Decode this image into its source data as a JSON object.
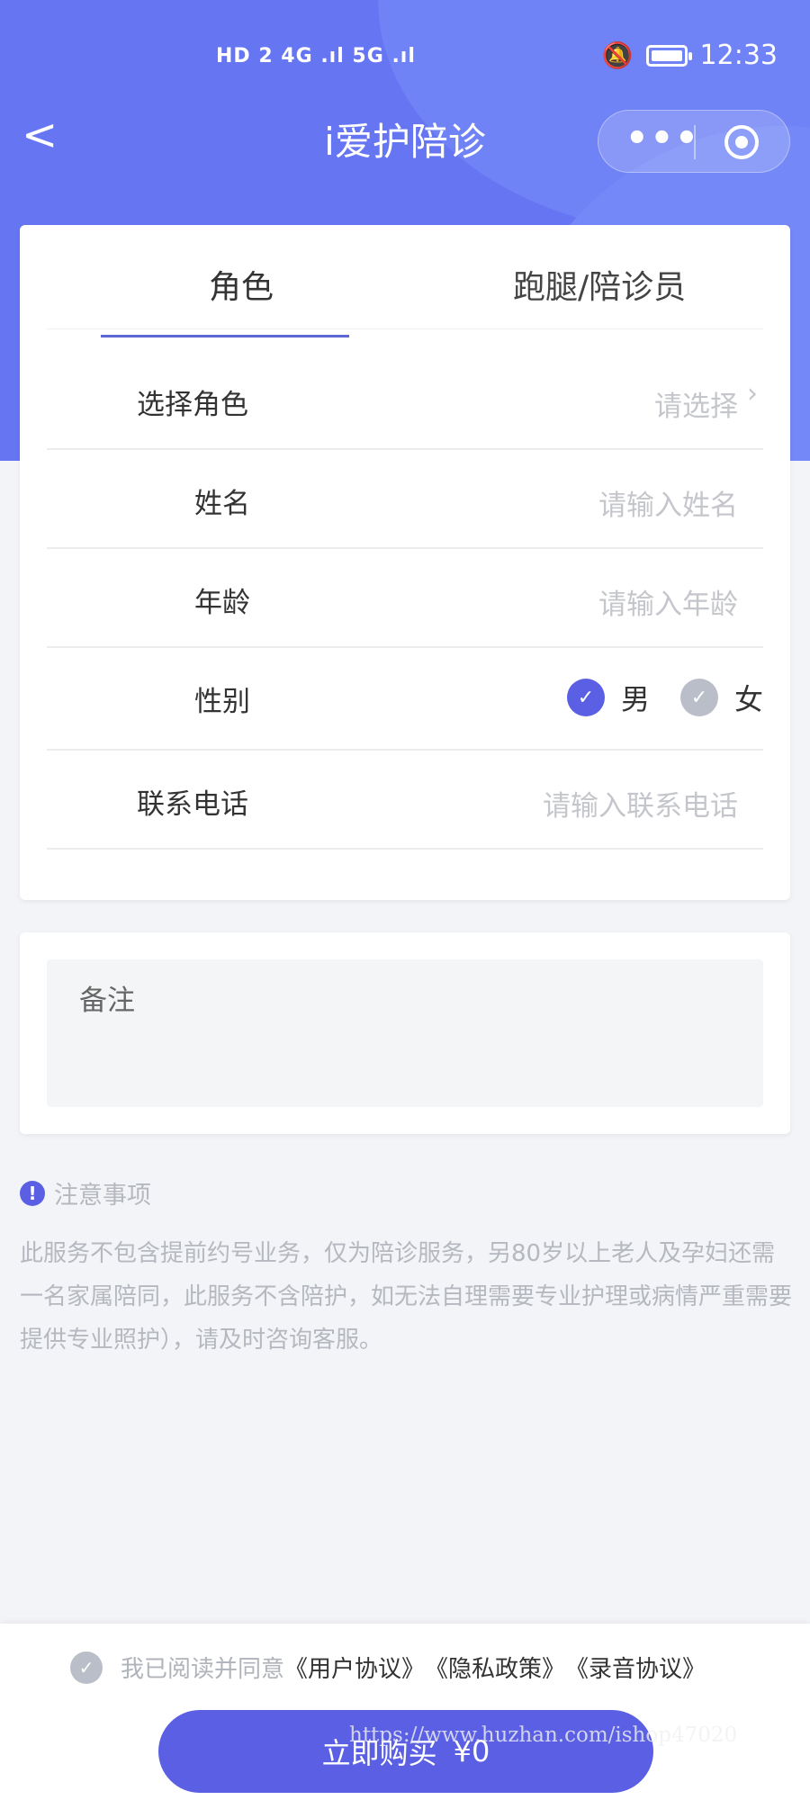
{
  "status_bar": {
    "network": "HD 2 4G .ıl 5G .ıl",
    "time": "12:33"
  },
  "navbar": {
    "back_label": "<",
    "title": "i爱护陪诊",
    "more_label": "•••"
  },
  "tabs": [
    {
      "label": "角色",
      "active": true
    },
    {
      "label": "跑腿/陪诊员",
      "active": false
    }
  ],
  "form": {
    "role": {
      "label": "选择角色",
      "placeholder": "请选择"
    },
    "name": {
      "label": "姓名",
      "placeholder": "请输入姓名"
    },
    "age": {
      "label": "年龄",
      "placeholder": "请输入年龄"
    },
    "gender": {
      "label": "性别",
      "options": [
        {
          "label": "男",
          "selected": true
        },
        {
          "label": "女",
          "selected": false
        }
      ]
    },
    "phone": {
      "label": "联系电话",
      "placeholder": "请输入联系电话"
    }
  },
  "remark": {
    "label": "备注"
  },
  "notice": {
    "title": "注意事项",
    "body": "此服务不包含提前约号业务，仅为陪诊服务，另80岁以上老人及孕妇还需一名家属陪同，此服务不含陪护，如无法自理需要专业护理或病情严重需要提供专业照护），请及时咨询客服。"
  },
  "agreement": {
    "prefix": "我已阅读并同意",
    "user": "《用户协议》",
    "privacy": "《隐私政策》",
    "recording": "《录音协议》"
  },
  "buy": {
    "label": "立即购买",
    "price": "¥0"
  },
  "watermark": "https://www.huzhan.com/ishop47020",
  "colors": {
    "primary": "#5a5fe3",
    "hero": "#6676f3",
    "background": "#f3f4f8"
  }
}
